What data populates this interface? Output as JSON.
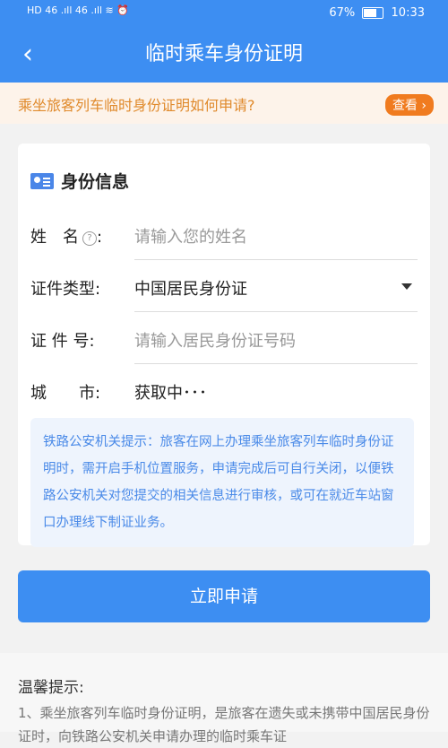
{
  "statusbar": {
    "left": "HD  46 .ıll  46 .ıll  ≋ ⏰",
    "right": "67%",
    "time": "10:33"
  },
  "header": {
    "title": "临时乘车身份证明",
    "back_icon": "chevron-left-icon"
  },
  "banner": {
    "text": "乘坐旅客列车临时身份证明如何申请?",
    "button": "查看 ›"
  },
  "card": {
    "heading": "身份信息",
    "fields": {
      "name": {
        "label": "姓　名",
        "suffix": ":",
        "placeholder": "请输入您的姓名"
      },
      "idtype": {
        "label": "证件类型:",
        "value": "中国居民身份证"
      },
      "idnum": {
        "label": "证 件 号:",
        "placeholder": "请输入居民身份证号码"
      },
      "city": {
        "label": "城　　市:",
        "value": "获取中･･･"
      }
    },
    "tip": "铁路公安机关提示：旅客在网上办理乘坐旅客列车临时身份证明时，需开启手机位置服务，申请完成后可自行关闭，以便铁路公安机关对您提交的相关信息进行审核，或可在就近车站窗口办理线下制证业务。"
  },
  "submit": "立即申请",
  "footer": {
    "title": "温馨提示:",
    "text": "1、乘坐旅客列车临时身份证明，是旅客在遗失或未携带中国居民身份证时，向铁路公安机关申请办理的临时乘车证"
  }
}
